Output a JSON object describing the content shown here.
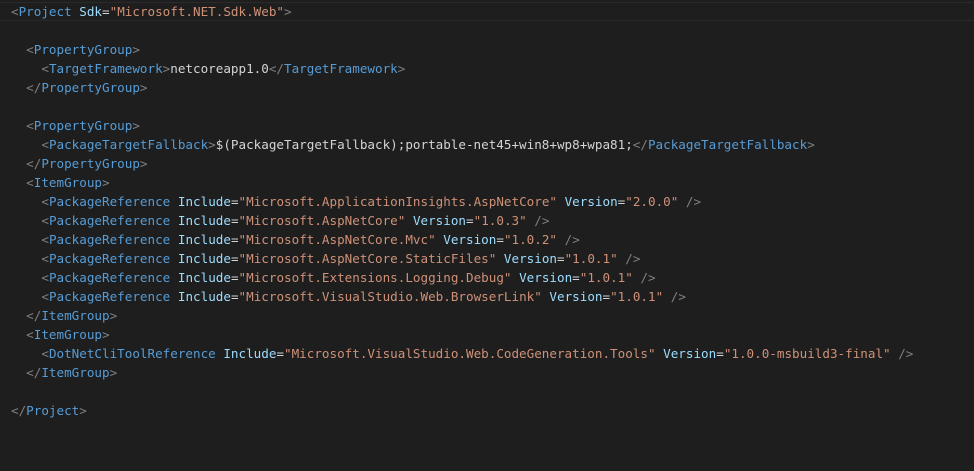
{
  "colors": {
    "background": "#1e1e1e",
    "tag": "#569cd6",
    "attribute": "#9cdcfe",
    "string": "#ce9178",
    "bracket": "#808080",
    "text": "#d4d4d4"
  },
  "code": {
    "indent": "  ",
    "lines": [
      {
        "i": 0,
        "t": [
          [
            "b",
            "<"
          ],
          [
            "g",
            "Project"
          ],
          [
            "s",
            " "
          ],
          [
            "a",
            "Sdk"
          ],
          [
            "e",
            "="
          ],
          [
            "v",
            "\"Microsoft.NET.Sdk.Web\""
          ],
          [
            "b",
            ">"
          ]
        ]
      },
      {
        "i": 0,
        "t": []
      },
      {
        "i": 1,
        "t": [
          [
            "b",
            "<"
          ],
          [
            "g",
            "PropertyGroup"
          ],
          [
            "b",
            ">"
          ]
        ]
      },
      {
        "i": 2,
        "t": [
          [
            "b",
            "<"
          ],
          [
            "g",
            "TargetFramework"
          ],
          [
            "b",
            ">"
          ],
          [
            "x",
            "netcoreapp1.0"
          ],
          [
            "b",
            "</"
          ],
          [
            "g",
            "TargetFramework"
          ],
          [
            "b",
            ">"
          ]
        ]
      },
      {
        "i": 1,
        "t": [
          [
            "b",
            "</"
          ],
          [
            "g",
            "PropertyGroup"
          ],
          [
            "b",
            ">"
          ]
        ]
      },
      {
        "i": 0,
        "t": []
      },
      {
        "i": 1,
        "t": [
          [
            "b",
            "<"
          ],
          [
            "g",
            "PropertyGroup"
          ],
          [
            "b",
            ">"
          ]
        ]
      },
      {
        "i": 2,
        "t": [
          [
            "b",
            "<"
          ],
          [
            "g",
            "PackageTargetFallback"
          ],
          [
            "b",
            ">"
          ],
          [
            "x",
            "$(PackageTargetFallback);portable-net45+win8+wp8+wpa81;"
          ],
          [
            "b",
            "</"
          ],
          [
            "g",
            "PackageTargetFallback"
          ],
          [
            "b",
            ">"
          ]
        ]
      },
      {
        "i": 1,
        "t": [
          [
            "b",
            "</"
          ],
          [
            "g",
            "PropertyGroup"
          ],
          [
            "b",
            ">"
          ]
        ]
      },
      {
        "i": 1,
        "t": [
          [
            "b",
            "<"
          ],
          [
            "g",
            "ItemGroup"
          ],
          [
            "b",
            ">"
          ]
        ]
      },
      {
        "i": 2,
        "t": [
          [
            "b",
            "<"
          ],
          [
            "g",
            "PackageReference"
          ],
          [
            "s",
            " "
          ],
          [
            "a",
            "Include"
          ],
          [
            "e",
            "="
          ],
          [
            "v",
            "\"Microsoft.ApplicationInsights.AspNetCore\""
          ],
          [
            "s",
            " "
          ],
          [
            "a",
            "Version"
          ],
          [
            "e",
            "="
          ],
          [
            "v",
            "\"2.0.0\""
          ],
          [
            "s",
            " "
          ],
          [
            "b",
            "/>"
          ]
        ]
      },
      {
        "i": 2,
        "t": [
          [
            "b",
            "<"
          ],
          [
            "g",
            "PackageReference"
          ],
          [
            "s",
            " "
          ],
          [
            "a",
            "Include"
          ],
          [
            "e",
            "="
          ],
          [
            "v",
            "\"Microsoft.AspNetCore\""
          ],
          [
            "s",
            " "
          ],
          [
            "a",
            "Version"
          ],
          [
            "e",
            "="
          ],
          [
            "v",
            "\"1.0.3\""
          ],
          [
            "s",
            " "
          ],
          [
            "b",
            "/>"
          ]
        ]
      },
      {
        "i": 2,
        "t": [
          [
            "b",
            "<"
          ],
          [
            "g",
            "PackageReference"
          ],
          [
            "s",
            " "
          ],
          [
            "a",
            "Include"
          ],
          [
            "e",
            "="
          ],
          [
            "v",
            "\"Microsoft.AspNetCore.Mvc\""
          ],
          [
            "s",
            " "
          ],
          [
            "a",
            "Version"
          ],
          [
            "e",
            "="
          ],
          [
            "v",
            "\"1.0.2\""
          ],
          [
            "s",
            " "
          ],
          [
            "b",
            "/>"
          ]
        ]
      },
      {
        "i": 2,
        "t": [
          [
            "b",
            "<"
          ],
          [
            "g",
            "PackageReference"
          ],
          [
            "s",
            " "
          ],
          [
            "a",
            "Include"
          ],
          [
            "e",
            "="
          ],
          [
            "v",
            "\"Microsoft.AspNetCore.StaticFiles\""
          ],
          [
            "s",
            " "
          ],
          [
            "a",
            "Version"
          ],
          [
            "e",
            "="
          ],
          [
            "v",
            "\"1.0.1\""
          ],
          [
            "s",
            " "
          ],
          [
            "b",
            "/>"
          ]
        ]
      },
      {
        "i": 2,
        "t": [
          [
            "b",
            "<"
          ],
          [
            "g",
            "PackageReference"
          ],
          [
            "s",
            " "
          ],
          [
            "a",
            "Include"
          ],
          [
            "e",
            "="
          ],
          [
            "v",
            "\"Microsoft.Extensions.Logging.Debug\""
          ],
          [
            "s",
            " "
          ],
          [
            "a",
            "Version"
          ],
          [
            "e",
            "="
          ],
          [
            "v",
            "\"1.0.1\""
          ],
          [
            "s",
            " "
          ],
          [
            "b",
            "/>"
          ]
        ]
      },
      {
        "i": 2,
        "t": [
          [
            "b",
            "<"
          ],
          [
            "g",
            "PackageReference"
          ],
          [
            "s",
            " "
          ],
          [
            "a",
            "Include"
          ],
          [
            "e",
            "="
          ],
          [
            "v",
            "\"Microsoft.VisualStudio.Web.BrowserLink\""
          ],
          [
            "s",
            " "
          ],
          [
            "a",
            "Version"
          ],
          [
            "e",
            "="
          ],
          [
            "v",
            "\"1.0.1\""
          ],
          [
            "s",
            " "
          ],
          [
            "b",
            "/>"
          ]
        ]
      },
      {
        "i": 1,
        "t": [
          [
            "b",
            "</"
          ],
          [
            "g",
            "ItemGroup"
          ],
          [
            "b",
            ">"
          ]
        ]
      },
      {
        "i": 1,
        "t": [
          [
            "b",
            "<"
          ],
          [
            "g",
            "ItemGroup"
          ],
          [
            "b",
            ">"
          ]
        ]
      },
      {
        "i": 2,
        "t": [
          [
            "b",
            "<"
          ],
          [
            "g",
            "DotNetCliToolReference"
          ],
          [
            "s",
            " "
          ],
          [
            "a",
            "Include"
          ],
          [
            "e",
            "="
          ],
          [
            "v",
            "\"Microsoft.VisualStudio.Web.CodeGeneration.Tools\""
          ],
          [
            "s",
            " "
          ],
          [
            "a",
            "Version"
          ],
          [
            "e",
            "="
          ],
          [
            "v",
            "\"1.0.0-msbuild3-final\""
          ],
          [
            "s",
            " "
          ],
          [
            "b",
            "/>"
          ]
        ]
      },
      {
        "i": 1,
        "t": [
          [
            "b",
            "</"
          ],
          [
            "g",
            "ItemGroup"
          ],
          [
            "b",
            ">"
          ]
        ]
      },
      {
        "i": 0,
        "t": []
      },
      {
        "i": 0,
        "t": [
          [
            "b",
            "</"
          ],
          [
            "g",
            "Project"
          ],
          [
            "b",
            ">"
          ]
        ]
      }
    ]
  }
}
